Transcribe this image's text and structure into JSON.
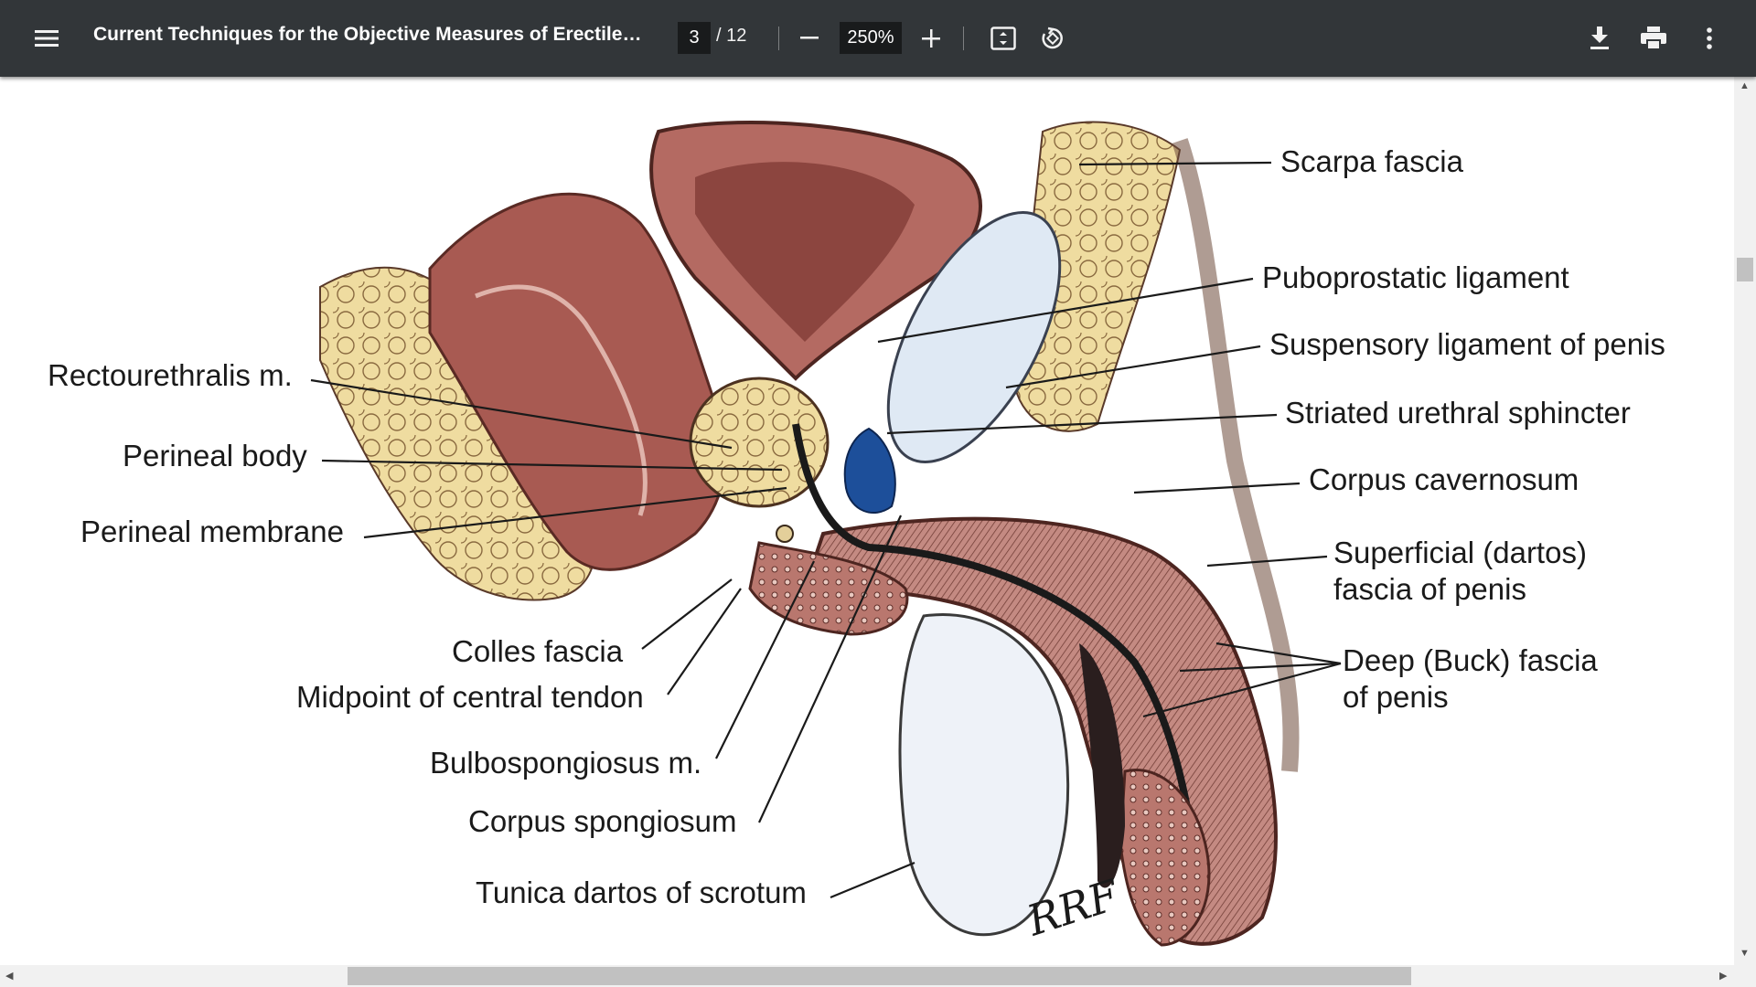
{
  "toolbar": {
    "menu_icon": "hamburger-menu-icon",
    "title": "Current Techniques for the Objective Measures of Erectile Hard...",
    "page_current": "3",
    "page_total": "/ 12",
    "zoom_value": "250%",
    "icons": [
      "minus-icon",
      "plus-icon",
      "fit-page-icon",
      "rotate-icon",
      "download-icon",
      "print-icon",
      "more-vert-icon"
    ]
  },
  "figure": {
    "labels_left": {
      "rectourethralis": "Rectourethralis m.",
      "perineal_body": "Perineal body",
      "perineal_membrane": "Perineal membrane",
      "colles": "Colles fascia",
      "central_tendon": "Midpoint of central tendon",
      "bulbospongiosus": "Bulbospongiosus m.",
      "corpus_spongiosum": "Corpus spongiosum",
      "tunica_dartos": "Tunica dartos of scrotum"
    },
    "labels_right": {
      "scarpa": "Scarpa fascia",
      "puboprostatic": "Puboprostatic ligament",
      "suspensory": "Suspensory ligament of penis",
      "striated": "Striated urethral sphincter",
      "cavernosum": "Corpus cavernosum",
      "dartos_line1": "Superficial (dartos)",
      "dartos_line2": "fascia of penis",
      "buck_line1": "Deep (Buck) fascia",
      "buck_line2": "of penis"
    },
    "signature": "RRF"
  },
  "colors": {
    "toolbar_bg": "#323639",
    "tissue_brown": "#8c4a42",
    "fat_yellow": "#efdca0",
    "sphincter_blue": "#1d4f9a"
  }
}
